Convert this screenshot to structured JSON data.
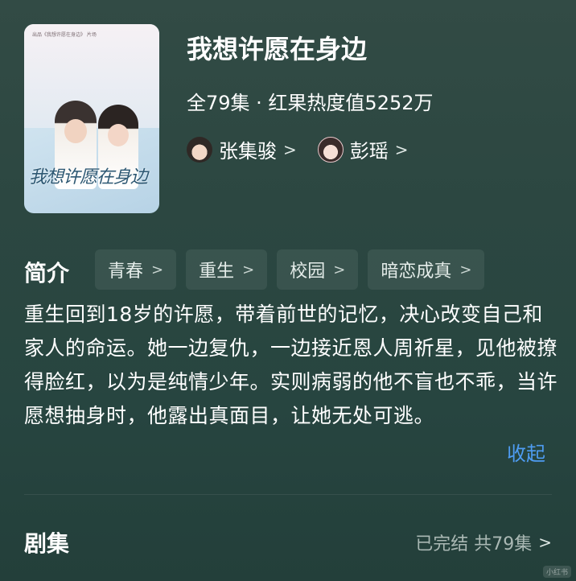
{
  "show": {
    "title": "我想许愿在身边",
    "meta": "全79集 · 红果热度值5252万",
    "poster_title": "我想许愿在身边",
    "poster_tiny": "出品《我想许愿在身边》 片场"
  },
  "cast": [
    {
      "name": "张集骏",
      "chevron": ">"
    },
    {
      "name": "彭瑶",
      "chevron": ">"
    }
  ],
  "intro": {
    "label": "简介",
    "tags": [
      {
        "label": "青春",
        "chevron": ">"
      },
      {
        "label": "重生",
        "chevron": ">"
      },
      {
        "label": "校园",
        "chevron": ">"
      },
      {
        "label": "暗恋成真",
        "chevron": ">"
      }
    ],
    "description": "重生回到18岁的许愿，带着前世的记忆，决心改变自己和家人的命运。她一边复仇，一边接近恩人周祈星，见他被撩得脸红，以为是纯情少年。实则病弱的他不盲也不乖，当许愿想抽身时，他露出真面目，让她无处可逃。",
    "collapse_label": "收起"
  },
  "episodes": {
    "label": "剧集",
    "status": "已完结 共79集",
    "chevron": ">"
  },
  "watermark": "小红书",
  "colors": {
    "background": "#2c4741",
    "link": "#4e9cf2",
    "muted": "#aab8b4"
  }
}
